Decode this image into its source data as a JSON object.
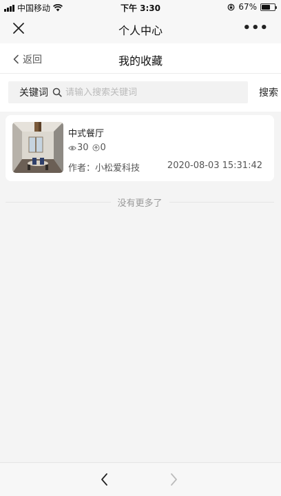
{
  "status_bar": {
    "carrier": "中国移动",
    "time": "下午 3:30",
    "battery_text": "67%",
    "battery_level": 0.67
  },
  "nav": {
    "title": "个人中心",
    "more": "•••"
  },
  "header": {
    "back_label": "返回",
    "title": "我的收藏"
  },
  "search": {
    "keyword_label": "关键词",
    "placeholder": "请输入搜索关键词",
    "value": "",
    "button_label": "搜索"
  },
  "favorites": [
    {
      "title": "中式餐厅",
      "views": "30",
      "likes": "0",
      "author": "作者：小松爱科技",
      "date": "2020-08-03 15:31:42"
    }
  ],
  "footer": {
    "no_more": "没有更多了"
  },
  "colors": {
    "background": "#f4f4f4",
    "card": "#ffffff",
    "muted_text": "#999999"
  }
}
